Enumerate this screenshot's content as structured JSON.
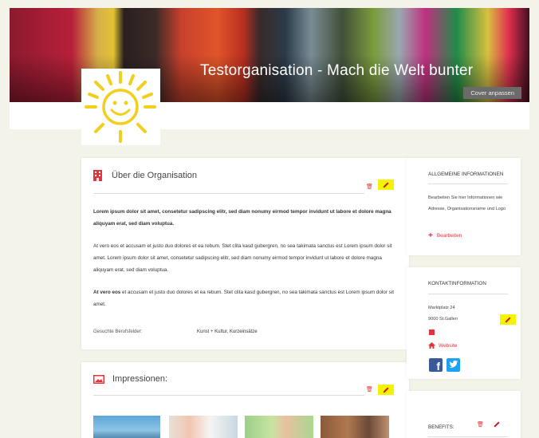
{
  "cover": {
    "title": "Testorganisation - Mach die Welt bunter",
    "adjust_button": "Cover anpassen"
  },
  "about": {
    "title": "Über die Organisation",
    "paragraph1": "Lorem ipsum dolor sit amet, consetetur sadipscing elitr, sed diam nonumy eirmod tempor invidunt ut labore et dolore magna aliquyam erat, sed diam voluptua.",
    "paragraph2": "At vero eos et accusam et justo duo dolores et ea rebum. Stet clita kasd gubergren, no sea takimata sanctus est Lorem ipsum dolor sit amet. Lorem ipsum dolor sit amet, consetetur sadipscing elitr, sed diam nonumy eirmod tempor invidunt ut labore et dolore magna aliquyam erat, sed diam voluptua.",
    "paragraph3_bold": "At vero eos",
    "paragraph3_rest": " et accusam et justo duo dolores et ea rebum. Stet clita kasd gubergren, no sea takimata sanctus est Lorem ipsum dolor sit amet.",
    "field_label": "Gesuchte Berufsfelder:",
    "field_value": "Kunst + Kultur, Kurzeinsätze"
  },
  "impressions": {
    "title": "Impressionen:"
  },
  "general_info": {
    "title": "ALLGEMEINE INFORMATIONEN",
    "text": "Bearbeiten Sie hier Informationen wie Adresse, Organisationsname und Logo",
    "edit_link": "Bearbeiten"
  },
  "contact": {
    "title": "KONTAKTINFORMATION",
    "street": "Marktplatz 24",
    "city": "9000 St.Gallen",
    "website_link": "Website"
  },
  "benefits": {
    "title": "BENEFITS:"
  },
  "colors": {
    "accent_red": "#e2343a",
    "highlight_yellow": "#f4f400",
    "facebook": "#3b5998",
    "twitter": "#1da1f2"
  }
}
